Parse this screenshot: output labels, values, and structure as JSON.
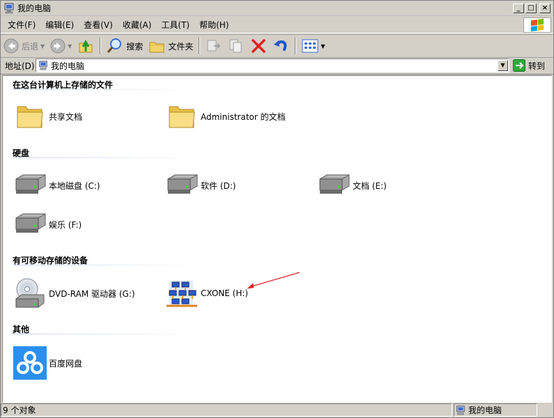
{
  "window": {
    "title": "我的电脑"
  },
  "title_buttons": {
    "minimize": "_",
    "maximize": "□",
    "close": "×"
  },
  "menu": [
    "文件(F)",
    "编辑(E)",
    "查看(V)",
    "收藏(A)",
    "工具(T)",
    "帮助(H)"
  ],
  "toolbar": {
    "back_label": "后退",
    "search_label": "搜索",
    "folders_label": "文件夹"
  },
  "address": {
    "label": "地址(D)",
    "value": "我的电脑",
    "go_label": "转到"
  },
  "groups": [
    {
      "title": "在这台计算机上存储的文件",
      "items": [
        "共享文档",
        "Administrator 的文档"
      ]
    },
    {
      "title": "硬盘",
      "items": [
        "本地磁盘 (C:)",
        "软件 (D:)",
        "文档 (E:)",
        "娱乐 (F:)"
      ]
    },
    {
      "title": "有可移动存储的设备",
      "items": [
        "DVD-RAM 驱动器 (G:)",
        "CXONE (H:)"
      ]
    },
    {
      "title": "其他",
      "items": [
        "百度网盘"
      ]
    }
  ],
  "status": {
    "count": "9 个对象",
    "location": "我的电脑"
  },
  "colors": {
    "annotation_arrow": "#e02020",
    "baidu_blue": "#2b8ff0"
  }
}
